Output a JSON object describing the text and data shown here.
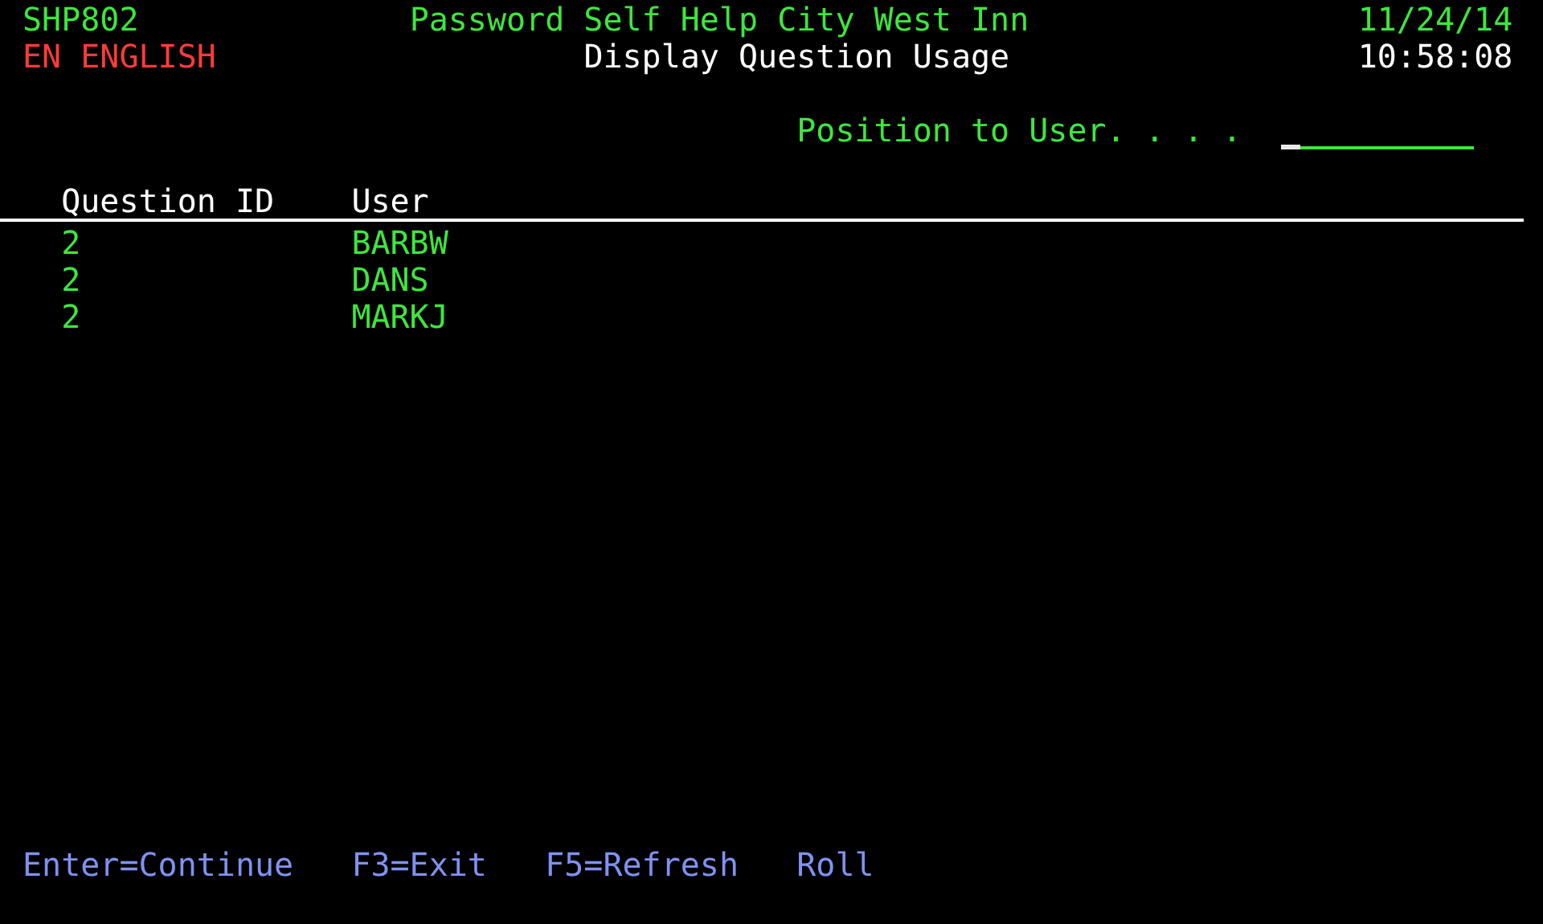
{
  "header": {
    "program": "SHP802",
    "title": "Password Self Help City West Inn",
    "date": "11/24/14",
    "language": "EN ENGLISH",
    "subtitle": "Display Question Usage",
    "time": "10:58:08"
  },
  "position_to": {
    "label": "Position to User. . . ."
  },
  "columns": [
    "Question ID",
    "User"
  ],
  "rows": [
    {
      "question_id": "2",
      "user": "BARBW"
    },
    {
      "question_id": "2",
      "user": "DANS"
    },
    {
      "question_id": "2",
      "user": "MARKJ"
    }
  ],
  "function_keys": [
    "Enter=Continue",
    "F3=Exit",
    "F5=Refresh",
    "Roll"
  ]
}
